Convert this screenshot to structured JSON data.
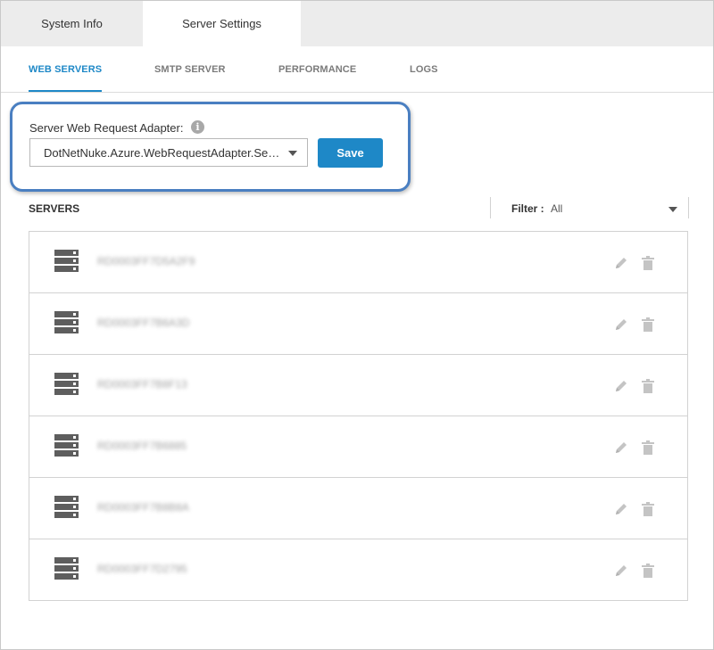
{
  "top_tabs": [
    {
      "label": "System Info",
      "active": false
    },
    {
      "label": "Server Settings",
      "active": true
    }
  ],
  "sub_tabs": [
    {
      "label": "WEB SERVERS",
      "active": true
    },
    {
      "label": "SMTP SERVER",
      "active": false
    },
    {
      "label": "PERFORMANCE",
      "active": false
    },
    {
      "label": "LOGS",
      "active": false
    }
  ],
  "adapter": {
    "label": "Server Web Request Adapter:",
    "info_icon": "info-circle-icon",
    "selected_value": "DotNetNuke.Azure.WebRequestAdapter.Ser...",
    "save_label": "Save"
  },
  "servers": {
    "title": "SERVERS",
    "filter_label": "Filter :",
    "filter_value": "All",
    "rows": [
      {
        "name": "RD0003FF7D5A2F9",
        "icon": "server-icon"
      },
      {
        "name": "RD0003FF7B6A3D",
        "icon": "server-icon"
      },
      {
        "name": "RD0003FF7B8F13",
        "icon": "server-icon"
      },
      {
        "name": "RD0003FF7B6885",
        "icon": "server-icon"
      },
      {
        "name": "RD0003FF7B8B8A",
        "icon": "server-icon"
      },
      {
        "name": "RD0003FF7D2795",
        "icon": "server-icon"
      }
    ]
  },
  "colors": {
    "accent": "#1e88c7",
    "highlight_border": "#4a7fc1",
    "tab_bar": "#ececec"
  }
}
